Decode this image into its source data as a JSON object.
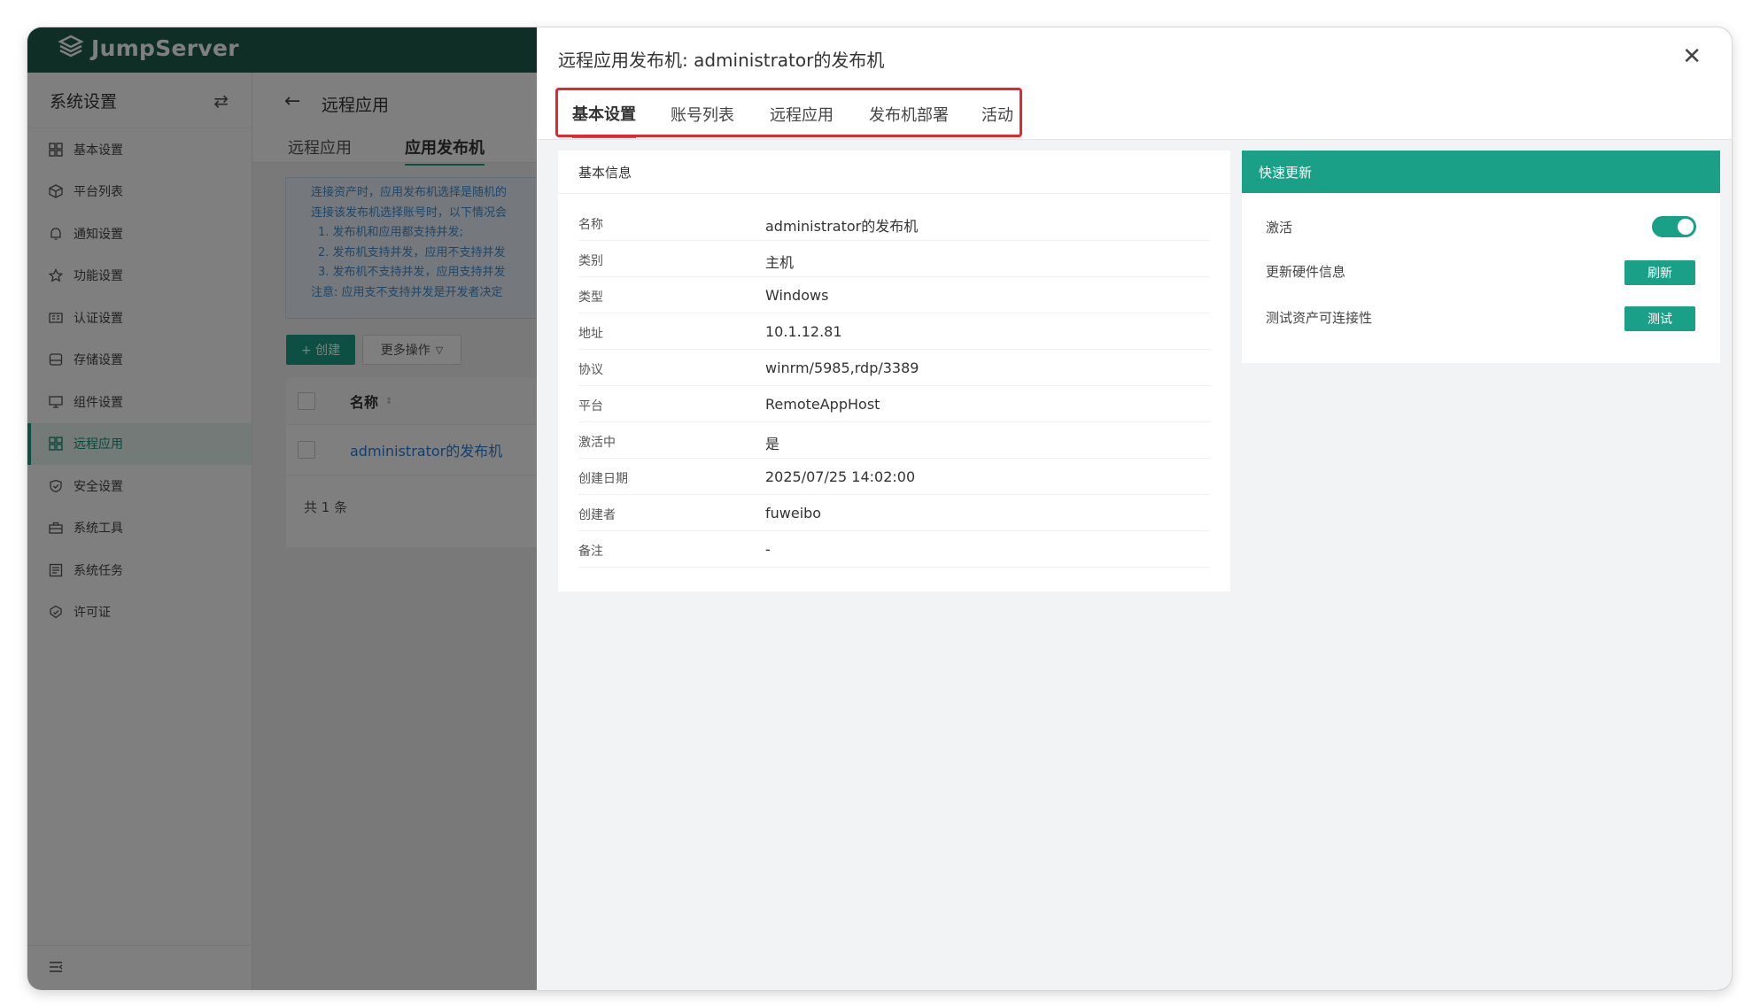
{
  "app": {
    "logo_text": "JumpServer"
  },
  "sidebar": {
    "title": "系统设置",
    "items": [
      {
        "label": "基本设置",
        "icon": "grid-icon"
      },
      {
        "label": "平台列表",
        "icon": "cube-icon"
      },
      {
        "label": "通知设置",
        "icon": "bell-icon"
      },
      {
        "label": "功能设置",
        "icon": "star-icon"
      },
      {
        "label": "认证设置",
        "icon": "id-card-icon"
      },
      {
        "label": "存储设置",
        "icon": "storage-icon"
      },
      {
        "label": "组件设置",
        "icon": "monitor-icon"
      },
      {
        "label": "远程应用",
        "icon": "apps-icon"
      },
      {
        "label": "安全设置",
        "icon": "shield-icon"
      },
      {
        "label": "系统工具",
        "icon": "toolbox-icon"
      },
      {
        "label": "系统任务",
        "icon": "tasks-icon"
      },
      {
        "label": "许可证",
        "icon": "license-icon"
      }
    ],
    "active_index": 7
  },
  "main": {
    "page_title": "远程应用",
    "tabs": [
      "远程应用",
      "应用发布机"
    ],
    "active_tab": 1,
    "notice_lines": [
      "连接资产时，应用发布机选择是随机的",
      "连接该发布机选择账号时，以下情况会",
      "  1. 发布机和应用都支持并发;",
      "  2. 发布机支持并发，应用不支持并发",
      "  3. 发布机不支持并发，应用支持并发",
      "注意: 应用支不支持并发是开发者决定"
    ],
    "create_button": "+ 创建",
    "more_button": "更多操作",
    "table": {
      "column_name": "名称",
      "rows": [
        "administrator的发布机"
      ],
      "total": "共 1 条"
    }
  },
  "drawer": {
    "title": "远程应用发布机: administrator的发布机",
    "tabs": [
      "基本设置",
      "账号列表",
      "远程应用",
      "发布机部署",
      "活动"
    ],
    "active_tab": 0,
    "basic_info": {
      "title": "基本信息",
      "rows": [
        {
          "label": "名称",
          "value": "administrator的发布机"
        },
        {
          "label": "类别",
          "value": "主机"
        },
        {
          "label": "类型",
          "value": "Windows"
        },
        {
          "label": "地址",
          "value": "10.1.12.81"
        },
        {
          "label": "协议",
          "value": "winrm/5985,rdp/3389"
        },
        {
          "label": "平台",
          "value": "RemoteAppHost"
        },
        {
          "label": "激活中",
          "value": "是"
        },
        {
          "label": "创建日期",
          "value": "2025/07/25 14:02:00"
        },
        {
          "label": "创建者",
          "value": "fuweibo"
        },
        {
          "label": "备注",
          "value": "-"
        }
      ]
    },
    "quick_update": {
      "title": "快速更新",
      "activate_label": "激活",
      "activate_on": true,
      "hardware_label": "更新硬件信息",
      "hardware_button": "刷新",
      "connectivity_label": "测试资产可连接性",
      "connectivity_button": "测试"
    }
  },
  "colors": {
    "accent": "#1aa087",
    "brand_dark": "#1d5c4c",
    "highlight": "#e0282e"
  }
}
